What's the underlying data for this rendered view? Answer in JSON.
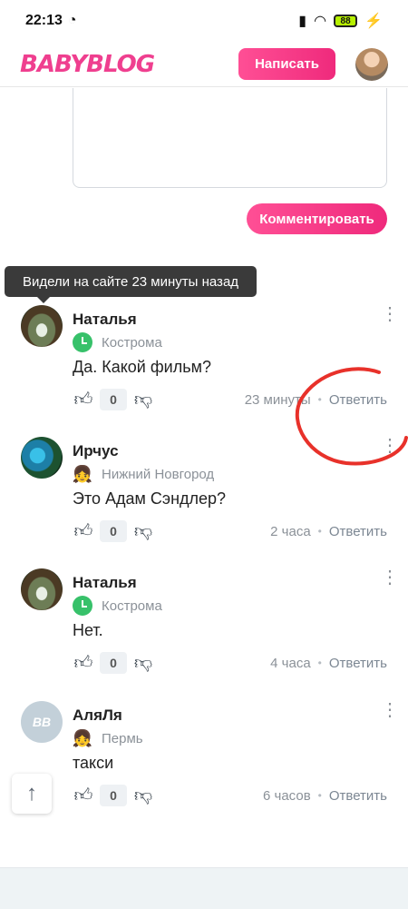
{
  "status": {
    "time": "22:13",
    "battery": "88"
  },
  "header": {
    "logo": "BABYBLOG",
    "write_label": "Написать"
  },
  "compose": {
    "submit_label": "Комментировать"
  },
  "tooltip": "Видели на сайте 23 минуты назад",
  "comments": [
    {
      "name": "Наталья",
      "city": "Кострома",
      "text": "Да. Какой фильм?",
      "likes": "0",
      "time": "23 минуты",
      "reply": "Ответить"
    },
    {
      "name": "Ирчус",
      "city": "Нижний Новгород",
      "text": "Это Адам Сэндлер?",
      "likes": "0",
      "time": "2 часа",
      "reply": "Ответить"
    },
    {
      "name": "Наталья",
      "city": "Кострома",
      "text": "Нет.",
      "likes": "0",
      "time": "4 часа",
      "reply": "Ответить"
    },
    {
      "name": "АляЛя",
      "city": "Пермь",
      "text": "такси",
      "likes": "0",
      "time": "6 часов",
      "reply": "Ответить",
      "avatar_text": "BB"
    }
  ],
  "colors": {
    "brand": "#ef3f8f",
    "annotation": "#e8312a"
  }
}
